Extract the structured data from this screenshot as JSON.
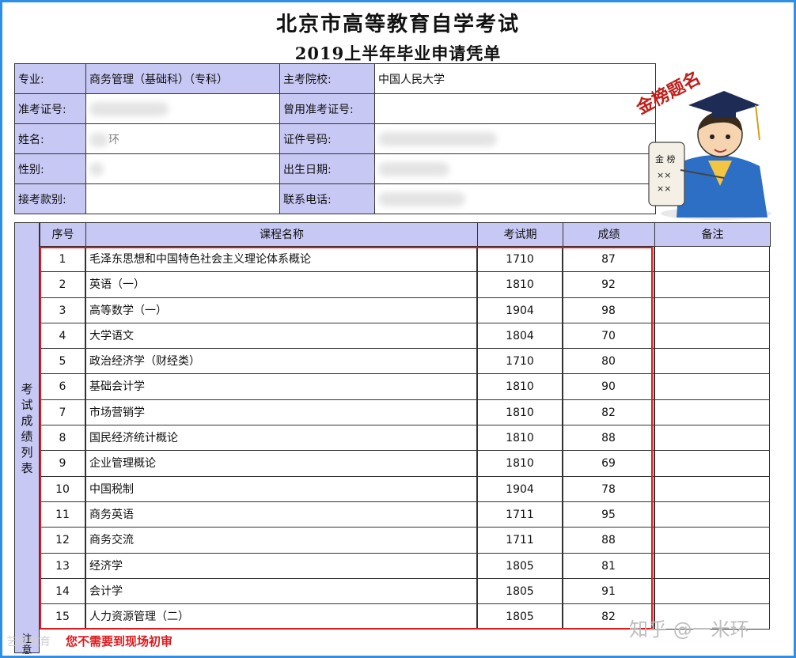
{
  "header": {
    "title": "北京市高等教育自学考试",
    "subtitle": "2019上半年毕业申请凭单"
  },
  "info": {
    "major_label": "专业:",
    "major_value": "商务管理（基础科）（专科）",
    "school_label": "主考院校:",
    "school_value": "中国人民大学",
    "exam_id_label": "准考证号:",
    "former_exam_id_label": "曾用准考证号:",
    "name_label": "姓名:",
    "name_value_partial": "环",
    "id_number_label": "证件号码:",
    "gender_label": "性别:",
    "birth_label": "出生日期:",
    "payment_label": "接考款别:",
    "phone_label": "联系电话:"
  },
  "badge": {
    "text": "金榜题名",
    "scroll_top": "金 榜",
    "scroll_marks": "××"
  },
  "table": {
    "side_label": "考试成绩列表",
    "side_footer": "注意",
    "columns": [
      "序号",
      "课程名称",
      "考试期",
      "成绩",
      "备注"
    ],
    "rows": [
      {
        "no": "1",
        "course": "毛泽东思想和中国特色社会主义理论体系概论",
        "term": "1710",
        "score": "87"
      },
      {
        "no": "2",
        "course": "英语（一）",
        "term": "1810",
        "score": "92"
      },
      {
        "no": "3",
        "course": "高等数学（一）",
        "term": "1904",
        "score": "98"
      },
      {
        "no": "4",
        "course": "大学语文",
        "term": "1804",
        "score": "70"
      },
      {
        "no": "5",
        "course": "政治经济学（财经类）",
        "term": "1710",
        "score": "80"
      },
      {
        "no": "6",
        "course": "基础会计学",
        "term": "1810",
        "score": "90"
      },
      {
        "no": "7",
        "course": "市场营销学",
        "term": "1810",
        "score": "82"
      },
      {
        "no": "8",
        "course": "国民经济统计概论",
        "term": "1810",
        "score": "88"
      },
      {
        "no": "9",
        "course": "企业管理概论",
        "term": "1810",
        "score": "69"
      },
      {
        "no": "10",
        "course": "中国税制",
        "term": "1904",
        "score": "78"
      },
      {
        "no": "11",
        "course": "商务英语",
        "term": "1711",
        "score": "95"
      },
      {
        "no": "12",
        "course": "商务交流",
        "term": "1711",
        "score": "88"
      },
      {
        "no": "13",
        "course": "经济学",
        "term": "1805",
        "score": "81"
      },
      {
        "no": "14",
        "course": "会计学",
        "term": "1805",
        "score": "91"
      },
      {
        "no": "15",
        "course": "人力资源管理（二）",
        "term": "1805",
        "score": "82"
      }
    ]
  },
  "footer": {
    "note": "您不需要到现场初审",
    "watermark_right": "知乎 @一米环",
    "watermark_left": "艺术教育"
  },
  "colors": {
    "frame": "#2f8fe6",
    "label_bg": "#c8c8f5",
    "highlight": "#e0191d"
  }
}
